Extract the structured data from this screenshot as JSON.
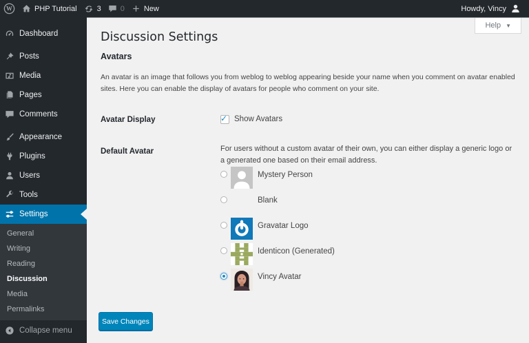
{
  "admin_bar": {
    "site_name": "PHP Tutorial",
    "updates_count": "3",
    "comments_count": "0",
    "new_label": "New",
    "howdy": "Howdy, Vincy"
  },
  "help": {
    "label": "Help"
  },
  "sidebar": {
    "items": [
      {
        "label": "Dashboard"
      },
      {
        "label": "Posts"
      },
      {
        "label": "Media"
      },
      {
        "label": "Pages"
      },
      {
        "label": "Comments"
      },
      {
        "label": "Appearance"
      },
      {
        "label": "Plugins"
      },
      {
        "label": "Users"
      },
      {
        "label": "Tools"
      },
      {
        "label": "Settings"
      }
    ],
    "settings_submenu": [
      {
        "label": "General",
        "current": false
      },
      {
        "label": "Writing",
        "current": false
      },
      {
        "label": "Reading",
        "current": false
      },
      {
        "label": "Discussion",
        "current": true
      },
      {
        "label": "Media",
        "current": false
      },
      {
        "label": "Permalinks",
        "current": false
      }
    ],
    "collapse_label": "Collapse menu"
  },
  "page": {
    "title": "Discussion Settings",
    "section_heading": "Avatars",
    "intro": "An avatar is an image that follows you from weblog to weblog appearing beside your name when you comment on avatar enabled sites. Here you can enable the display of avatars for people who comment on your site.",
    "avatar_display_label": "Avatar Display",
    "show_avatars_label": "Show Avatars",
    "show_avatars_checked": true,
    "default_avatar_label": "Default Avatar",
    "default_avatar_desc": "For users without a custom avatar of their own, you can either display a generic logo or a generated one based on their email address.",
    "options": [
      {
        "label": "Mystery Person",
        "selected": false
      },
      {
        "label": "Blank",
        "selected": false
      },
      {
        "label": "Gravatar Logo",
        "selected": false
      },
      {
        "label": "Identicon (Generated)",
        "selected": false
      },
      {
        "label": "Vincy Avatar",
        "selected": true
      }
    ],
    "save_button": "Save Changes"
  },
  "colors": {
    "accent": "#0073aa",
    "button": "#0085ba",
    "adminbar_bg": "#23282d",
    "content_bg": "#f1f1f1"
  }
}
